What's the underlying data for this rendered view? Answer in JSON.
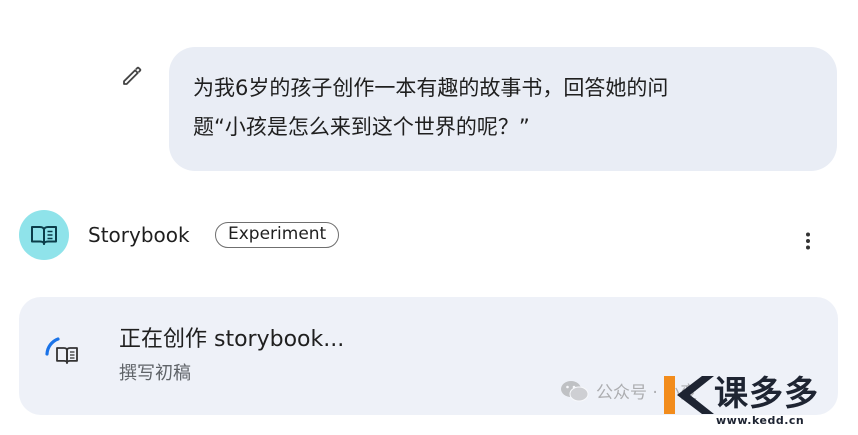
{
  "prompt": {
    "line1": "为我6岁的孩子创作一本有趣的故事书，回答她的问",
    "line2": "题“小孩是怎么来到这个世界的呢？”"
  },
  "icons": {
    "edit": "pencil-icon",
    "avatar": "open-book-icon",
    "more": "more-vert-icon",
    "spinner": "loading-spinner-icon",
    "status": "open-book-icon"
  },
  "agent": {
    "name": "Storybook",
    "badge": "Experiment"
  },
  "status": {
    "title": "正在创作 storybook...",
    "subtitle": "撰写初稿"
  },
  "watermark": {
    "wechat_label": "公众号 · 小变",
    "brand": "课多多",
    "url": "www.kedd.cn"
  },
  "colors": {
    "bubble_bg": "#e9edf5",
    "avatar_bg": "#8fe3ea",
    "card_bg": "#eef1f8",
    "spinner_blue": "#1a73e8",
    "brand_orange": "#f28c1c"
  }
}
